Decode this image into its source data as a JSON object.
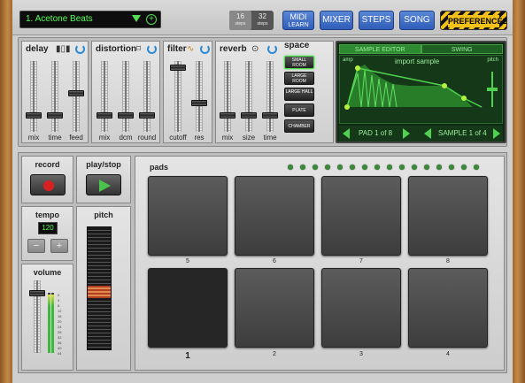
{
  "topbar": {
    "song": "1. Acetone Beats",
    "steps16": "16",
    "steps32": "32",
    "steps_unit": "steps",
    "midi_learn_1": "MIDI",
    "midi_learn_2": "LEARN",
    "mixer": "MIXER",
    "steps": "STEPS",
    "song_btn": "SONG",
    "preferences": "PREFERENCES"
  },
  "fx": {
    "delay": {
      "title": "delay",
      "labels": [
        "mix",
        "time",
        "feed"
      ],
      "levels": [
        0.2,
        0.2,
        0.55
      ]
    },
    "distortion": {
      "title": "distortion",
      "labels": [
        "mix",
        "dcm",
        "round"
      ],
      "levels": [
        0.2,
        0.2,
        0.2
      ]
    },
    "filter": {
      "title": "filter",
      "labels": [
        "cutoff",
        "res"
      ],
      "levels": [
        0.95,
        0.4
      ]
    },
    "reverb": {
      "title": "reverb",
      "labels": [
        "mix",
        "size",
        "time"
      ],
      "levels": [
        0.2,
        0.2,
        0.2
      ]
    },
    "space": {
      "title": "space",
      "buttons": [
        "SMALL ROOM",
        "LARGE ROOM",
        "LARGE HALL",
        "PLATE",
        "CHAMBER"
      ],
      "selected": "SMALL ROOM"
    }
  },
  "editor": {
    "tab_sample": "SAMPLE EDITOR",
    "tab_swing": "SWING",
    "amp": "amp",
    "import": "import sample",
    "pitch": "pitch",
    "pad": "PAD 1 of 8",
    "sample": "SAMPLE 1 of 4",
    "accent": "#4fd24f"
  },
  "transport": {
    "record": "record",
    "playstop": "play/stop",
    "tempo_title": "tempo",
    "tempo": "120",
    "minus": "−",
    "plus": "+",
    "pitch_title": "pitch",
    "volume_title": "volume",
    "volume_level": 0.85,
    "scale": [
      "0",
      "4",
      "8",
      "12",
      "16",
      "20",
      "24",
      "28",
      "32",
      "36",
      "40",
      "44"
    ]
  },
  "pads": {
    "title": "pads",
    "row_top": [
      "5",
      "6",
      "7",
      "8"
    ],
    "row_bottom": [
      "1",
      "2",
      "3",
      "4"
    ],
    "selected": "1"
  }
}
